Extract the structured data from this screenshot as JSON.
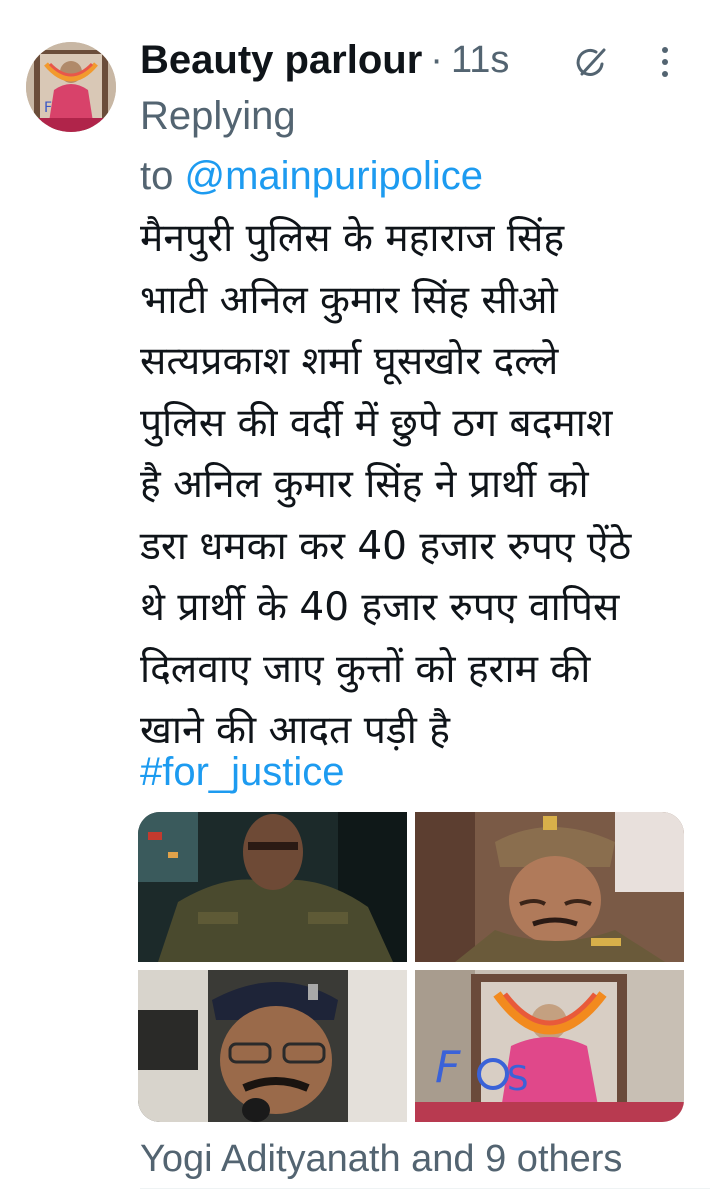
{
  "tweet": {
    "author": "Beauty parlour",
    "separator": "·",
    "time": "11s",
    "reply_prefix": "Replying",
    "reply_to": "to",
    "reply_handle": "@mainpuripolice",
    "body_lines": [
      "मैनपुरी पुलिस के महाराज सिंह",
      "भाटी अनिल कुमार सिंह सीओ",
      "सत्यप्रकाश शर्मा घूसखोर दल्ले",
      "पुलिस की वर्दी में छुपे ठग बदमाश",
      "है अनिल कुमार सिंह ने प्रार्थी को",
      "डरा धमका कर 40 हजार रुपए ऐंठे",
      "थे प्रार्थी के 40 हजार रुपए वापिस",
      "दिलवाए जाए कुत्तों को हराम की",
      "खाने की आदत पड़ी है"
    ],
    "hashtag": "#for_justice",
    "media_count": 4,
    "liked_by": "Yogi Adityanath and 9 others"
  },
  "icons": {
    "grok": "grok-icon",
    "more": "more-vertical-icon"
  },
  "colors": {
    "link": "#1d9bf0",
    "secondary_text": "#536471",
    "primary_text": "#0f1419",
    "background": "#ffffff"
  }
}
